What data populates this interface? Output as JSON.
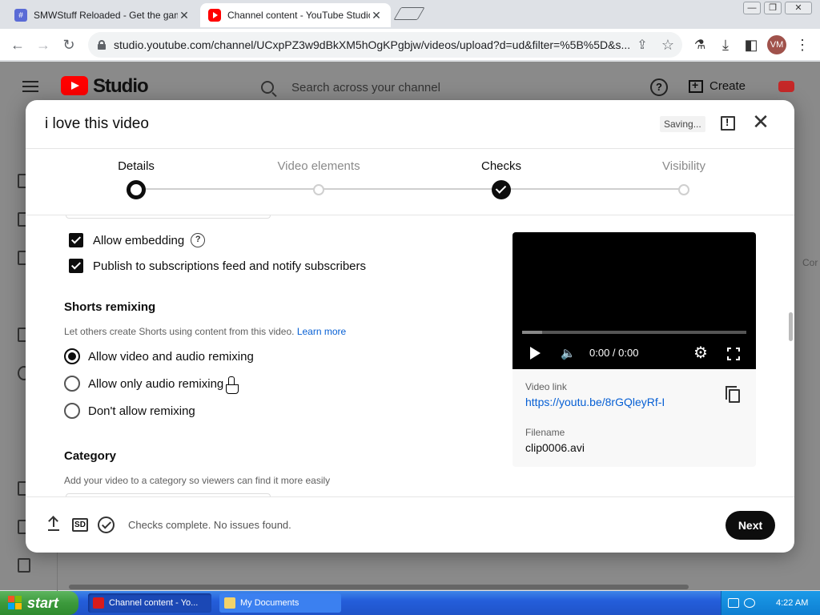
{
  "browser": {
    "tabs": [
      {
        "title": "SMWStuff Reloaded - Get the game",
        "close": "✕",
        "active": false
      },
      {
        "title": "Channel content - YouTube Studio",
        "close": "✕",
        "active": true
      }
    ],
    "window_controls": {
      "minimize": "—",
      "restore": "❐",
      "close": "✕"
    },
    "url": "studio.youtube.com/channel/UCxpPZ3w9dBkXM5hOgKPgbjw/videos/upload?d=ud&filter=%5B%5D&s...",
    "profile_initials": "VM"
  },
  "studio": {
    "brand": "Studio",
    "search_placeholder": "Search across your channel",
    "help_symbol": "?",
    "create_label": "Create",
    "cut_off_text": "Cor"
  },
  "dialog": {
    "title": "i love this video",
    "saving_label": "Saving...",
    "close_symbol": "✕",
    "steps": [
      {
        "label": "Details",
        "state": "current"
      },
      {
        "label": "Video elements",
        "state": "todo"
      },
      {
        "label": "Checks",
        "state": "done"
      },
      {
        "label": "Visibility",
        "state": "todo"
      }
    ],
    "checkboxes": [
      {
        "label": "Allow embedding",
        "checked": true,
        "help": "?"
      },
      {
        "label": "Publish to subscriptions feed and notify subscribers",
        "checked": true
      }
    ],
    "shorts": {
      "title": "Shorts remixing",
      "description": "Let others create Shorts using content from this video.",
      "learn_more": "Learn more",
      "options": [
        {
          "label": "Allow video and audio remixing",
          "selected": true
        },
        {
          "label": "Allow only audio remixing",
          "selected": false
        },
        {
          "label": "Don't allow remixing",
          "selected": false
        }
      ]
    },
    "category": {
      "title": "Category",
      "description": "Add your video to a category so viewers can find it more easily"
    },
    "preview": {
      "time": "0:00 / 0:00",
      "progress_buffered": 0.09,
      "video_link_label": "Video link",
      "video_link": "https://youtu.be/8rGQleyRf-I",
      "filename_label": "Filename",
      "filename": "clip0006.avi"
    },
    "footer": {
      "sd_badge": "SD",
      "status": "Checks complete. No issues found.",
      "next_label": "Next"
    }
  },
  "taskbar": {
    "start_label": "start",
    "tasks": [
      {
        "label": "Channel content - Yo..."
      },
      {
        "label": "My Documents"
      }
    ],
    "clock": "4:22 AM"
  },
  "colors": {
    "accent_link": "#065fd4",
    "youtube_red": "#ff0000",
    "primary_button": "#0d0d0d",
    "xp_start_green": "#3c9a3c",
    "xp_taskbar_blue": "#245edb"
  }
}
